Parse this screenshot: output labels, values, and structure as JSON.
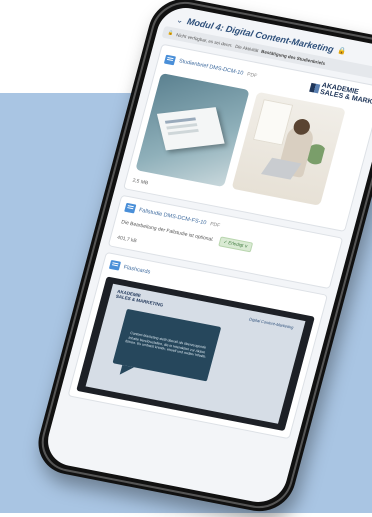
{
  "module": {
    "title": "Modul 4: Digital Content-Marketing",
    "notice_prefix": "Nicht verfügbar, es sei denn:",
    "notice_text": "Die Aktivität",
    "notice_bold": "Bestätigung des Studienbriefs"
  },
  "brand": {
    "line1": "AKADEMIE",
    "line2": "SALES & MARK"
  },
  "items": [
    {
      "name": "Studienbrief DMS-DCM-10",
      "type": "PDF",
      "size": "2,5 MB"
    },
    {
      "name": "Fallstudie DMS-DCM-FS-10",
      "type": "PDF",
      "size": "401,7 kB",
      "note": "Die Bearbeitung der Fallstudie ist optional.",
      "badge": "✓ Erledigt ∨"
    },
    {
      "name": "Flashcards"
    }
  ],
  "flashcard": {
    "logo_line1": "AKADEMIE",
    "logo_line2": "SALES & MARKETING",
    "tag": "Digital Content-Marketing",
    "text": "Content-Marketing stellt überall als überzeugende Inhalte bereitzustellen, die in Interaktion zur Aktion führen. Es umfasst kreativ, visuell und audiov Inhalte."
  }
}
